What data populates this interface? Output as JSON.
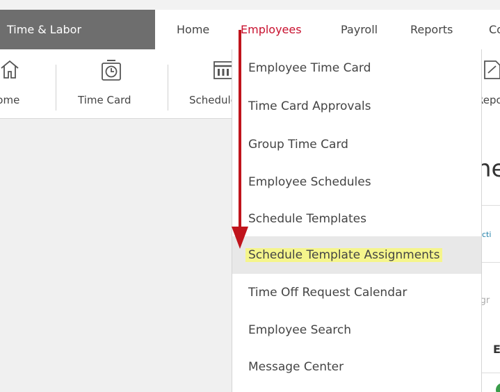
{
  "nav": {
    "brand": "Time & Labor",
    "items": [
      {
        "label": "Home"
      },
      {
        "label": "Employees"
      },
      {
        "label": "Payroll"
      },
      {
        "label": "Reports"
      },
      {
        "label": "Co"
      }
    ],
    "active_color": "#c8102e"
  },
  "toolbar": {
    "items": [
      {
        "label": "Home",
        "icon": "home-icon"
      },
      {
        "label": "Time Card",
        "icon": "stopwatch-icon"
      },
      {
        "label": "Schedules",
        "icon": "calendar-icon"
      },
      {
        "label": "Reports",
        "icon": "report-icon"
      }
    ]
  },
  "dropdown": {
    "items": [
      {
        "label": "Employee Time Card"
      },
      {
        "label": "Time Card Approvals"
      },
      {
        "label": "Group Time Card"
      },
      {
        "label": "Employee Schedules"
      },
      {
        "label": "Schedule Templates"
      },
      {
        "label": "Schedule Template Assignments"
      },
      {
        "label": "Time Off Request Calendar"
      },
      {
        "label": "Employee Search"
      },
      {
        "label": "Message Center"
      }
    ],
    "selected_index": 5,
    "highlight_color": "#f5f58c"
  },
  "right_pane": {
    "heading_fragment": "he",
    "tab_fragment": "cti",
    "small_fragment": "igr",
    "bold_fragment": "E"
  },
  "annotation": {
    "arrow_color": "#c0141c",
    "icon": "arrow-down-icon"
  }
}
